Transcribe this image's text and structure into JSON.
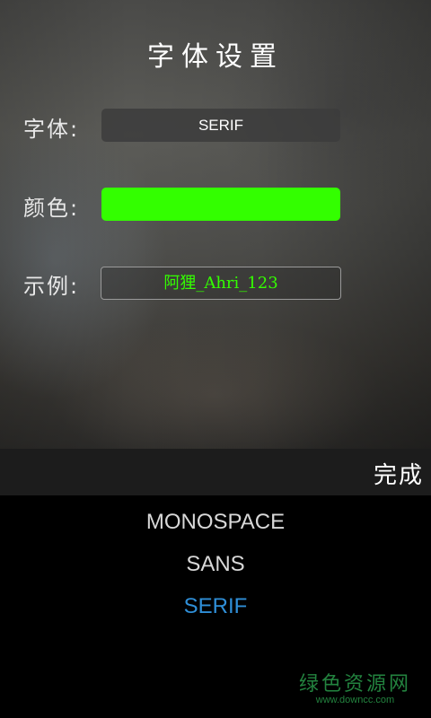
{
  "header": {
    "title": "字体设置"
  },
  "settings": {
    "font_label": "字体:",
    "font_value": "SERIF",
    "color_label": "颜色:",
    "color_value": "#33ff00",
    "sample_label": "示例:",
    "sample_text": "阿狸_Ahri_123",
    "sample_color": "#33ff00"
  },
  "toolbar": {
    "done_label": "完成"
  },
  "picker": {
    "options": [
      "MONOSPACE",
      "SANS",
      "SERIF"
    ],
    "selected": "SERIF",
    "selected_color": "#2f8fd8"
  },
  "watermark": {
    "name": "绿色资源网",
    "url": "www.downcc.com"
  }
}
